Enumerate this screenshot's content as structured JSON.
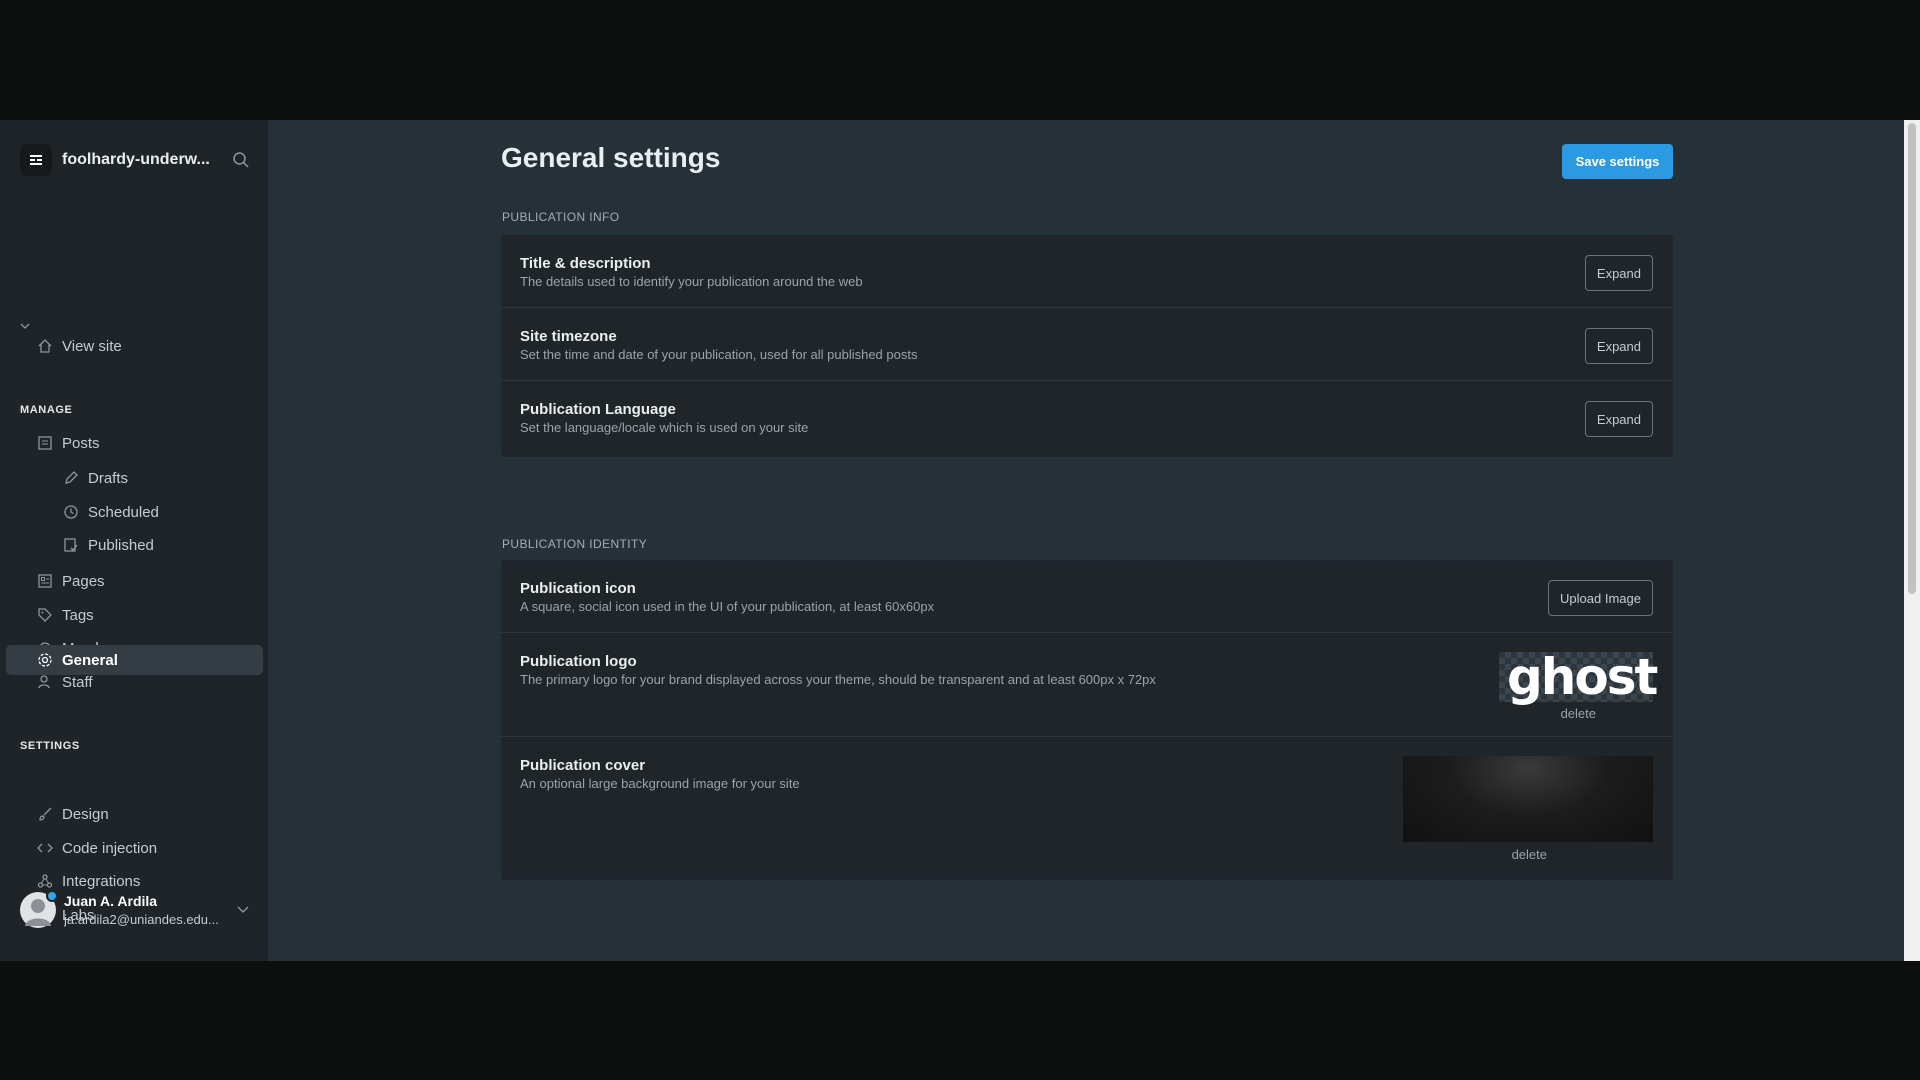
{
  "sidebar": {
    "site_title": "foolhardy-underw...",
    "view_site": "View site",
    "manage_label": "MANAGE",
    "posts": "Posts",
    "drafts": "Drafts",
    "scheduled": "Scheduled",
    "published": "Published",
    "pages": "Pages",
    "tags": "Tags",
    "members": "Members",
    "staff": "Staff",
    "settings_label": "SETTINGS",
    "general": "General",
    "design": "Design",
    "code_injection": "Code injection",
    "integrations": "Integrations",
    "labs": "Labs",
    "user_name": "Juan A. Ardila",
    "user_email": "ja.ardila2@uniandes.edu..."
  },
  "main": {
    "title": "General settings",
    "save_label": "Save settings",
    "pub_info_label": "PUBLICATION INFO",
    "pub_identity_label": "PUBLICATION IDENTITY",
    "rows_info": [
      {
        "title": "Title & description",
        "desc": "The details used to identify your publication around the web",
        "button": "Expand"
      },
      {
        "title": "Site timezone",
        "desc": "Set the time and date of your publication, used for all published posts",
        "button": "Expand"
      },
      {
        "title": "Publication Language",
        "desc": "Set the language/locale which is used on your site",
        "button": "Expand"
      }
    ],
    "icon_row": {
      "title": "Publication icon",
      "desc": "A square, social icon used in the UI of your publication, at least 60x60px",
      "button": "Upload Image"
    },
    "logo_row": {
      "title": "Publication logo",
      "desc": "The primary logo for your brand displayed across your theme, should be transparent and at least 600px x 72px",
      "logo_text": "ghost",
      "delete": "delete"
    },
    "cover_row": {
      "title": "Publication cover",
      "desc": "An optional large background image for your site",
      "delete": "delete"
    }
  },
  "colors": {
    "accent": "#2c9ae3",
    "background": "#263037",
    "sidebar": "#1e2428",
    "panel": "#1f2529"
  }
}
